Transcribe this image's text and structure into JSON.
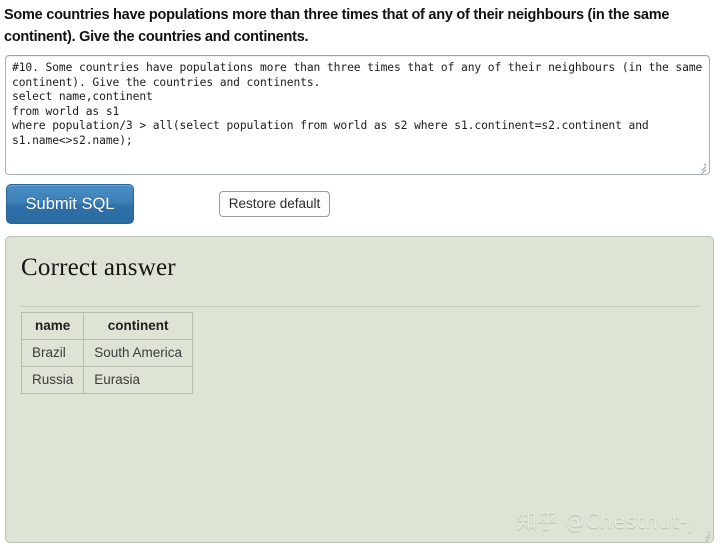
{
  "question": {
    "text": "Some countries have populations more than three times that of any of their neighbours (in the same continent). Give the countries and continents."
  },
  "editor": {
    "name": "sql-editor",
    "value": "#10. Some countries have populations more than three times that of any of their neighbours (in the same continent). Give the countries and continents.\nselect name,continent\nfrom world as s1\nwhere population/3 > all(select population from world as s2 where s1.continent=s2.continent and s1.name<>s2.name);",
    "placeholder": "",
    "resize_handle_icon": "resize-grip-icon"
  },
  "toolbar": {
    "submit_label": "Submit SQL",
    "restore_label": "Restore default"
  },
  "result": {
    "title": "Correct answer",
    "table": {
      "columns": [
        "name",
        "continent"
      ],
      "rows": [
        [
          "Brazil",
          "South America"
        ],
        [
          "Russia",
          "Eurasia"
        ]
      ]
    }
  },
  "watermark": {
    "text": "知乎 @Chestnut-J"
  },
  "colors": {
    "submit_button": "#3d81ba",
    "result_panel_bg": "#dde4d6",
    "result_panel_border": "#b9c3b2",
    "table_border": "#b4beac",
    "page_bg": "#ffffff",
    "text": "#1a1a1a"
  }
}
